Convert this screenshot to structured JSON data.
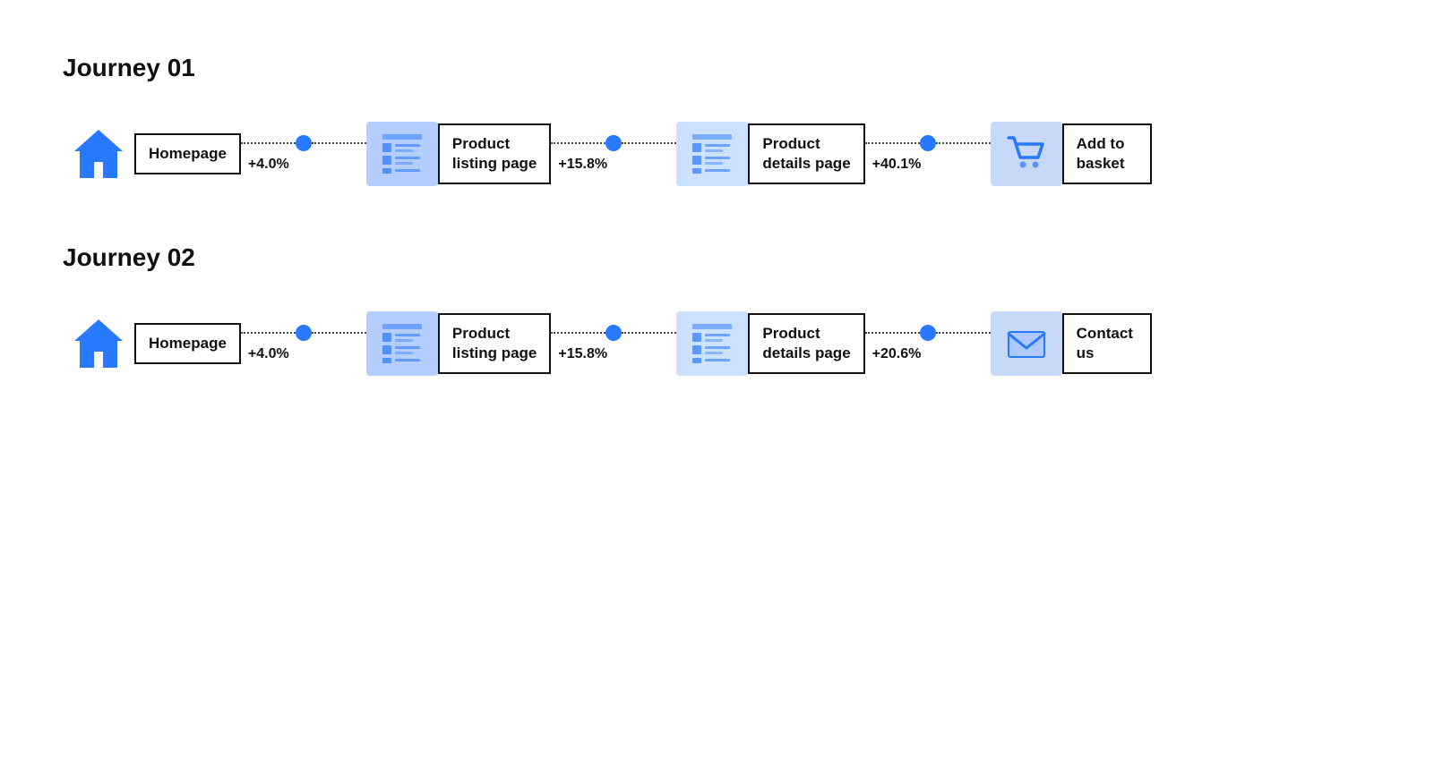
{
  "journeys": [
    {
      "id": "journey-01",
      "title": "Journey 01",
      "steps": [
        {
          "id": "home",
          "type": "home",
          "label": "Homepage"
        },
        {
          "id": "listing",
          "type": "listing",
          "label": "Product\nlisting page"
        },
        {
          "id": "details",
          "type": "details",
          "label": "Product\ndetails page"
        },
        {
          "id": "basket",
          "type": "basket",
          "label": "Add to\nbasket"
        }
      ],
      "connectors": [
        {
          "pct": "+4.0%"
        },
        {
          "pct": "+15.8%"
        },
        {
          "pct": "+40.1%"
        }
      ]
    },
    {
      "id": "journey-02",
      "title": "Journey 02",
      "steps": [
        {
          "id": "home",
          "type": "home",
          "label": "Homepage"
        },
        {
          "id": "listing",
          "type": "listing",
          "label": "Product\nlisting page"
        },
        {
          "id": "details",
          "type": "details",
          "label": "Product\ndetails page"
        },
        {
          "id": "contact",
          "type": "contact",
          "label": "Contact\nus"
        }
      ],
      "connectors": [
        {
          "pct": "+4.0%"
        },
        {
          "pct": "+15.8%"
        },
        {
          "pct": "+20.6%"
        }
      ]
    }
  ]
}
